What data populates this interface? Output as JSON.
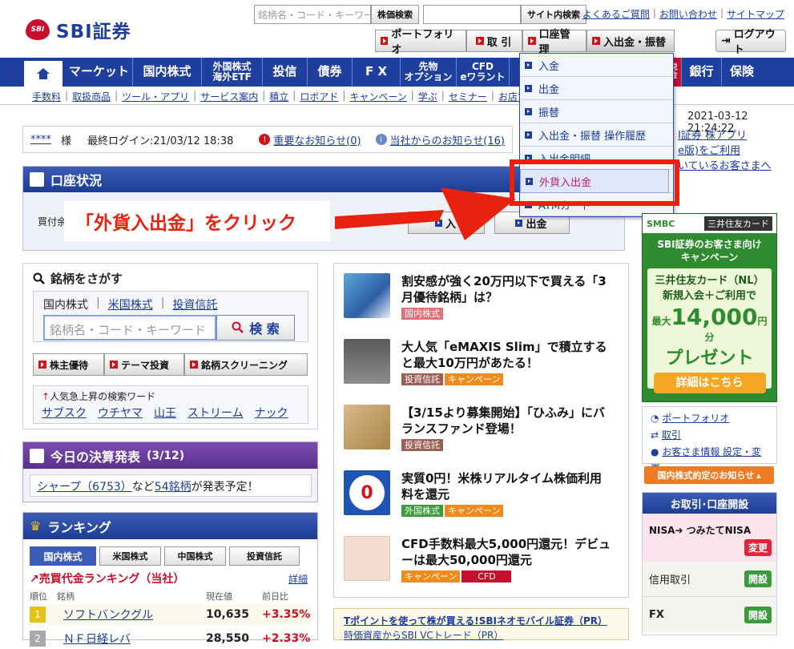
{
  "header": {
    "logo_mark": "SBI",
    "logo_text": "SBI証券",
    "search_placeholder": "銘柄名・コード・キーワード",
    "stock_search_btn": "株価検索",
    "site_search_btn": "サイト内検索",
    "links": [
      "よくあるご質問",
      "お問い合わせ",
      "サイトマップ"
    ],
    "func_buttons": [
      "ポートフォリオ",
      "取 引",
      "口座管理",
      "入出金・振替"
    ],
    "logout": "ログアウト"
  },
  "nav": {
    "items": [
      "マーケット",
      "国内株式",
      "外国株式\n海外ETF",
      "投信",
      "債券",
      "F X",
      "先物\nオプション",
      "CFD\neワラント",
      "",
      "",
      "銀行",
      "保険"
    ],
    "tax_label": "節税\n年金"
  },
  "subnav": [
    "手数料",
    "取扱商品",
    "ツール・アプリ",
    "サービス案内",
    "積立",
    "ロボアド",
    "キャンペーン",
    "学ぶ",
    "セミナー",
    "お店で"
  ],
  "dropdown": {
    "items": [
      "入金",
      "出金",
      "振替",
      "入出金・振替 操作履歴",
      "入出金明細",
      "外貨入出金",
      "ATMカード"
    ]
  },
  "datetime": "2021-03-12 21:24:22",
  "user": {
    "name": "****",
    "suffix": "様",
    "last_login": "最終ログイン:21/03/12 18:38",
    "notice_important": "重要なお知らせ(0)",
    "notice_company": "当社からのお知らせ(16)"
  },
  "right_links": [
    "I証券 株アプリ",
    "e版)をご利用",
    "いているお客さまへ"
  ],
  "account": {
    "title": "口座状況",
    "left_label": "買付余",
    "btn_in": "入",
    "btn_out": "出金"
  },
  "annotation": "「外貨入出金」をクリック",
  "search_panel": {
    "title": "銘柄をさがす",
    "tabs": [
      "国内株式",
      "米国株式",
      "投資信託"
    ],
    "placeholder": "銘柄名・コード・キーワード",
    "search_btn": "検 索",
    "tools": [
      "株主優待",
      "テーマ投資",
      "銘柄スクリーニング"
    ],
    "popular_label": "人気急上昇の検索ワード",
    "popular": [
      "サブスク",
      "ウチヤマ",
      "山王",
      "ストリーム",
      "ナック"
    ]
  },
  "earnings": {
    "title": "今日の決算発表",
    "date": "(3/12)",
    "company": "シャープ（6753）",
    "mid": "など",
    "count": "54銘柄",
    "tail": "が発表予定！"
  },
  "ranking": {
    "title": "ランキング",
    "tabs": [
      "国内株式",
      "米国株式",
      "中国株式",
      "投資信託"
    ],
    "sub_title": "売買代金ランキング（当社）",
    "detail": "詳細",
    "headers": [
      "順位",
      "銘柄",
      "現在値",
      "前日比"
    ],
    "rows": [
      {
        "rank": "1",
        "name": "ソフトバンクグル",
        "price": "10,635",
        "change": "+3.35%"
      },
      {
        "rank": "2",
        "name": "ＮＦ日経レバ",
        "price": "28,550",
        "change": "+2.33%"
      }
    ]
  },
  "news": [
    {
      "text": "割安感が強く20万円以下で買える「3月優待銘柄」は？",
      "tags": [
        "国内株式"
      ]
    },
    {
      "text": "大人気「eMAXIS Slim」で積立すると最大10万円があたる！",
      "tags": [
        "投資信託",
        "キャンペーン"
      ]
    },
    {
      "text": "【3/15より募集開始】「ひふみ」にバランスファンド登場！",
      "tags": [
        "投資信託"
      ]
    },
    {
      "text": "実質0円！米株リアルタイム株価利用料を還元",
      "tags": [
        "外国株式",
        "キャンペーン"
      ]
    },
    {
      "text": "CFD手数料最大5,000円還元！デビューは最大50,000円還元",
      "tags": [
        "キャンペーン",
        "CFD"
      ]
    }
  ],
  "tpoint": {
    "text": "Tポイントを使って株が買える!SBIネオモバイル証券（PR）",
    "text2": "時価資産からSBI VCトレード（PR）"
  },
  "ad": {
    "brand": "SMBC",
    "card": "三井住友カード",
    "line1": "SBI証券のお客さま向け",
    "line2": "キャンペーン",
    "line3": "三井住友カード（NL）",
    "line4": "新規入会＋ご利用で",
    "max": "最大",
    "amount": "14,000",
    "unit": "円分",
    "present": "プレゼント",
    "cta": "詳細はこちら"
  },
  "side_links": [
    "ポートフォリオ",
    "取引",
    "お客さま情報 設定・変更"
  ],
  "notice_btn": "国内株式約定のお知らせ",
  "open_acct": {
    "title": "お取引･口座開設",
    "rows": [
      {
        "label": "NISA➜ つみたてNISA",
        "btn": "変更"
      },
      {
        "label": "信用取引",
        "btn": "開設"
      },
      {
        "label": "FX",
        "btn": "開設"
      }
    ]
  },
  "colors": {
    "brand": "#1e3f9d",
    "red": "#e8220f",
    "accent_magenta": "#c01c7c"
  }
}
